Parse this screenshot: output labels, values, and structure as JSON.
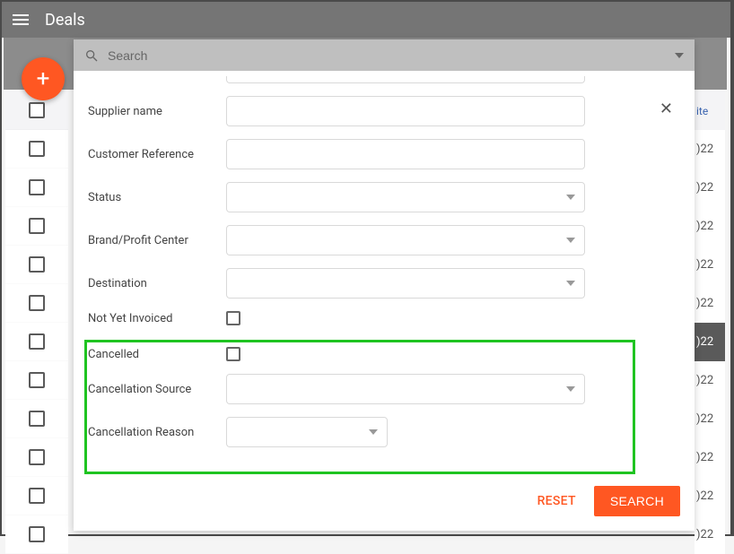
{
  "header": {
    "title": "Deals"
  },
  "fab": {
    "label": "+"
  },
  "search": {
    "placeholder": "Search"
  },
  "form": {
    "supplier_name": "Supplier name",
    "customer_reference": "Customer Reference",
    "status": "Status",
    "brand": "Brand/Profit Center",
    "destination": "Destination",
    "not_yet_invoiced": "Not Yet Invoiced",
    "cancelled": "Cancelled",
    "cancel_source": "Cancellation Source",
    "cancel_reason": "Cancellation Reason"
  },
  "actions": {
    "reset": "RESET",
    "search": "SEARCH"
  },
  "rightColumn": {
    "header": "ite",
    "cells": [
      ")22",
      ")22",
      ")22",
      ")22",
      ")22",
      ")22",
      ")22",
      ")22",
      ")22",
      ")22",
      ")22"
    ]
  }
}
